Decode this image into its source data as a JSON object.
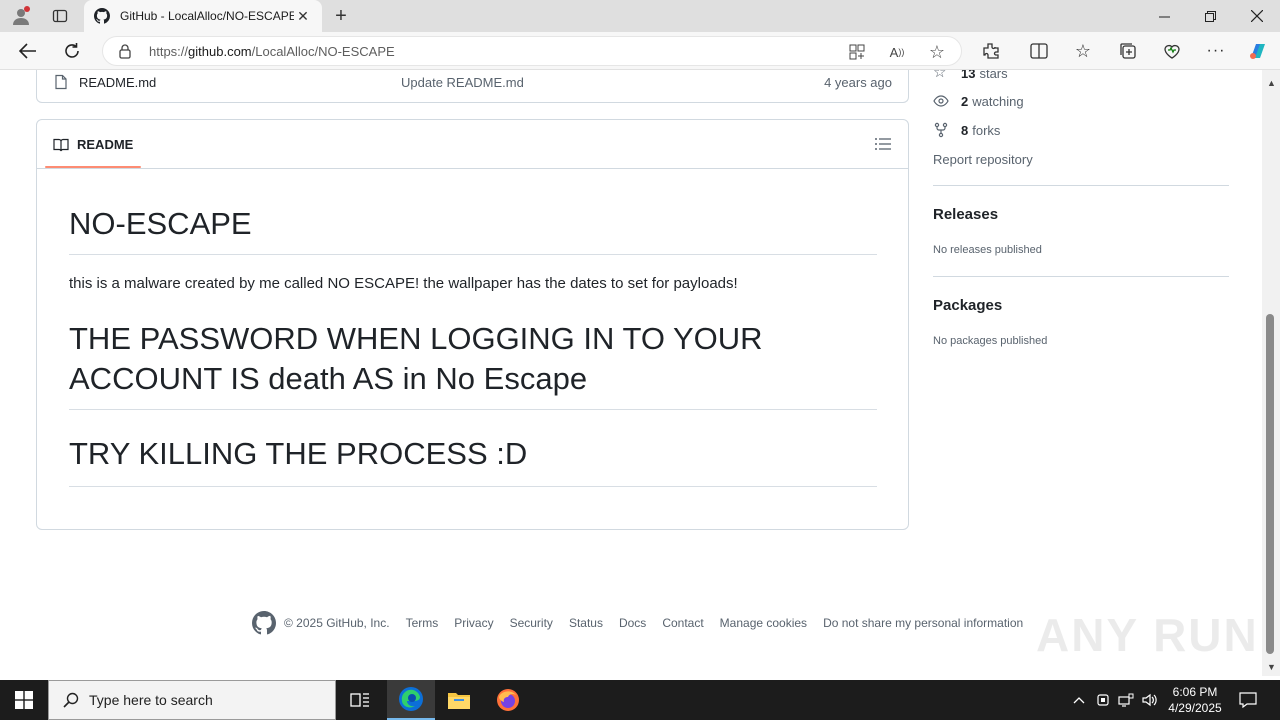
{
  "browser": {
    "tab_title": "GitHub - LocalAlloc/NO-ESCAPE",
    "url_proto": "https://",
    "url_host": "github.com",
    "url_path": "/LocalAlloc/NO-ESCAPE"
  },
  "files": [
    {
      "name": "README.md",
      "message": "Update README.md",
      "date": "4 years ago"
    }
  ],
  "readme": {
    "tab_label": "README",
    "title": "NO-ESCAPE",
    "description": "this is a malware created by me called NO ESCAPE! the wallpaper has the dates to set for payloads!",
    "heading_password": "THE PASSWORD WHEN LOGGING IN TO YOUR ACCOUNT IS death AS in No Escape",
    "heading_kill": "TRY KILLING THE PROCESS :D"
  },
  "sidebar": {
    "stars_count": "13",
    "stars_label": "stars",
    "watching_count": "2",
    "watching_label": "watching",
    "forks_count": "8",
    "forks_label": "forks",
    "report": "Report repository",
    "releases_heading": "Releases",
    "releases_text": "No releases published",
    "packages_heading": "Packages",
    "packages_text": "No packages published"
  },
  "footer": {
    "copyright": "© 2025 GitHub, Inc.",
    "links": [
      "Terms",
      "Privacy",
      "Security",
      "Status",
      "Docs",
      "Contact",
      "Manage cookies",
      "Do not share my personal information"
    ]
  },
  "watermark": "ANY RUN",
  "taskbar": {
    "search_placeholder": "Type here to search",
    "time": "6:06 PM",
    "date": "4/29/2025"
  },
  "colors": {
    "tab_underline": "#fd8c73",
    "border": "#d1d9e0",
    "muted_text": "#59636e",
    "taskbar": "#1c1c1c"
  },
  "icons": [
    "profile-icon",
    "tab-actions-icon",
    "github-favicon",
    "close-tab-icon",
    "new-tab-icon",
    "minimize-icon",
    "restore-icon",
    "close-window-icon",
    "back-icon",
    "refresh-icon",
    "lock-icon",
    "app-available-icon",
    "read-aloud-icon",
    "favorite-star-icon",
    "extensions-icon",
    "split-screen-icon",
    "favorites-icon",
    "collections-icon",
    "browser-essentials-icon",
    "more-icon",
    "copilot-icon",
    "file-icon",
    "book-icon",
    "toc-list-icon",
    "star-icon",
    "eye-icon",
    "fork-icon",
    "github-logo-icon",
    "windows-start-icon",
    "search-icon",
    "task-view-icon",
    "edge-icon",
    "file-explorer-icon",
    "firefox-icon",
    "chevron-up-icon",
    "network-icon",
    "volume-icon",
    "notification-icon"
  ]
}
